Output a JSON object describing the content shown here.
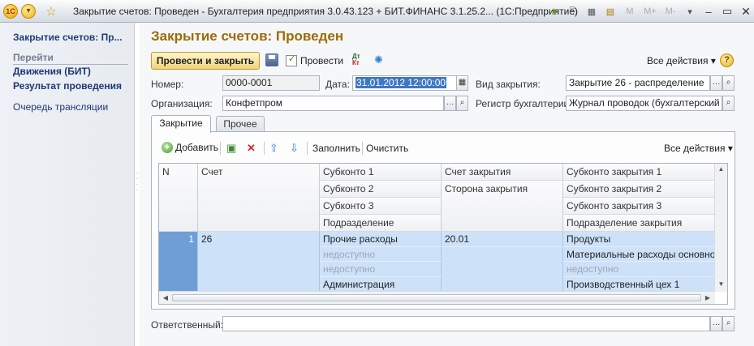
{
  "window": {
    "title": "Закрытие счетов: Проведен - Бухгалтерия предприятия 3.0.43.123 + БИТ.ФИНАНС 3.1.25.2...   (1С:Предприятие)",
    "logo_text": "1С",
    "m_buttons": [
      "M",
      "M+",
      "M-"
    ]
  },
  "left_panel": {
    "command_title": "Закрытие счетов: Пр...",
    "go_label": "Перейти",
    "nav": [
      "Движения (БИТ)",
      "Результат проведения",
      "Очередь трансляции"
    ]
  },
  "form": {
    "title": "Закрытие счетов: Проведен",
    "toolbar": {
      "post_and_close": "Провести и закрыть",
      "post": "Провести",
      "dtkt_top": "Дт",
      "dtkt_bottom": "Кт",
      "all_actions": "Все действия",
      "help": "?"
    },
    "fields": {
      "number_label": "Номер:",
      "number_value": "0000-0001",
      "date_label": "Дата:",
      "date_value": "31.01.2012 12:00:00",
      "closing_type_label": "Вид закрытия:",
      "closing_type_value": "Закрытие 26 - распределение",
      "org_label": "Организация:",
      "org_value": "Конфетпром",
      "register_label": "Регистр бухгалтерии:",
      "register_value": "Журнал проводок (бухгалтерский и н",
      "responsible_label": "Ответственный:",
      "responsible_value": ""
    },
    "tabs": [
      "Закрытие",
      "Прочее"
    ],
    "table_toolbar": {
      "add": "Добавить",
      "fill": "Заполнить",
      "clear": "Очистить",
      "all_actions": "Все действия"
    },
    "table": {
      "headers": {
        "n": "N",
        "account": "Счет",
        "sub1": "Субконто 1",
        "sub2": "Субконто 2",
        "sub3": "Субконто 3",
        "dept": "Подразделение",
        "close_account": "Счет закрытия",
        "close_side": "Сторона закрытия",
        "close_sub1": "Субконто закрытия 1",
        "close_sub2": "Субконто закрытия 2",
        "close_sub3": "Субконто закрытия 3",
        "close_dept": "Подразделение закрытия"
      },
      "rows": [
        {
          "n": "1",
          "account": "26",
          "sub1": "Прочие расходы",
          "sub2": "недоступно",
          "sub3": "недоступно",
          "dept": "Администрация",
          "close_account": "20.01",
          "close_side": "",
          "close_sub1": "Продукты",
          "close_sub2": "Материальные расходы основного п",
          "close_sub3": "недоступно",
          "close_dept": "Производственный цех 1"
        }
      ]
    }
  }
}
